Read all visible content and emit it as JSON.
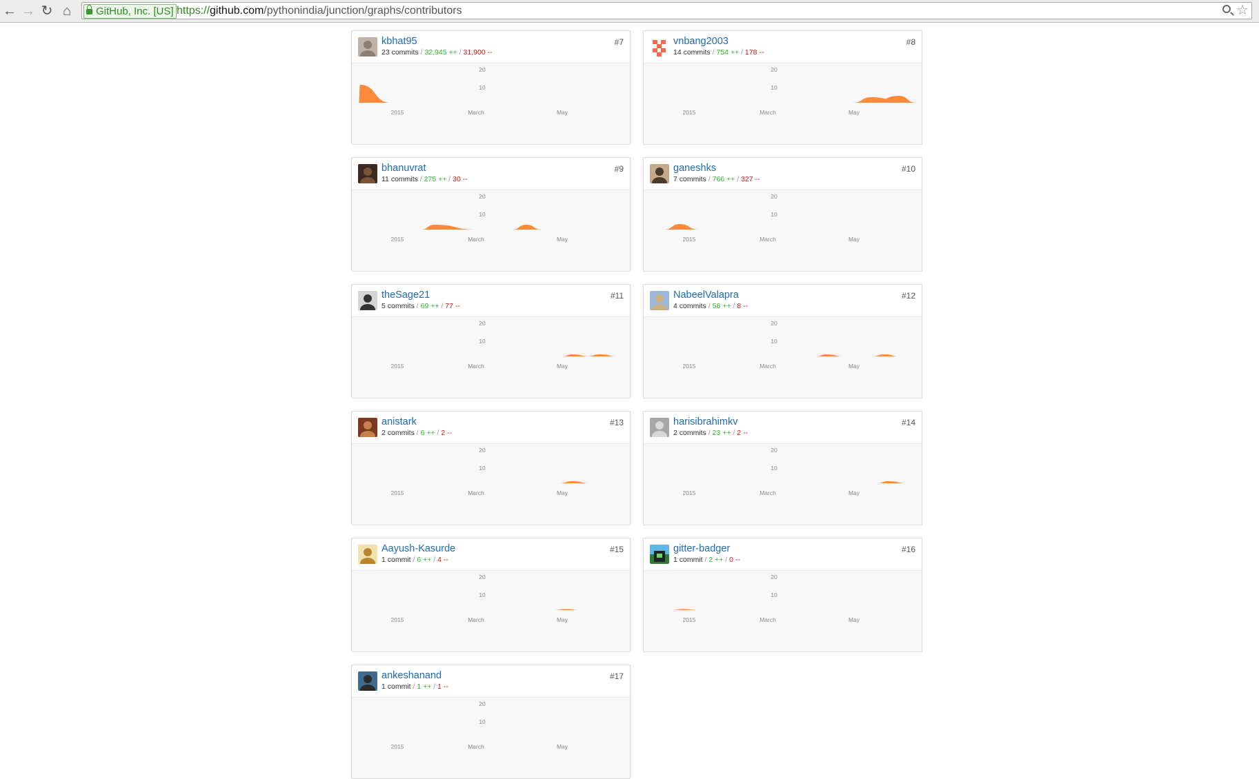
{
  "browser": {
    "ev_label": "GitHub, Inc. [US]",
    "url_scheme": "https://",
    "url_host": "github.com",
    "url_path": "/pythonindia/junction/graphs/contributors",
    "icons": [
      "back-arrow-icon",
      "forward-arrow-icon",
      "reload-icon",
      "home-icon",
      "lock-icon",
      "search-icon",
      "star-icon"
    ]
  },
  "chart_defaults": {
    "y_ticks": [
      "20",
      "10"
    ],
    "x_ticks": [
      "2015",
      "March",
      "May"
    ],
    "area_color": "#fb8532"
  },
  "contributors": [
    {
      "username": "kbhat95",
      "rank": "#7",
      "commits": "23 commits",
      "additions": "32,945 ++",
      "deletions": "31,900 --"
    },
    {
      "username": "vnbang2003",
      "rank": "#8",
      "commits": "14 commits",
      "additions": "754 ++",
      "deletions": "178 --"
    },
    {
      "username": "bhanuvrat",
      "rank": "#9",
      "commits": "11 commits",
      "additions": "275 ++",
      "deletions": "30 --"
    },
    {
      "username": "ganeshks",
      "rank": "#10",
      "commits": "7 commits",
      "additions": "766 ++",
      "deletions": "327 --"
    },
    {
      "username": "theSage21",
      "rank": "#11",
      "commits": "5 commits",
      "additions": "69 ++",
      "deletions": "77 --"
    },
    {
      "username": "NabeelValapra",
      "rank": "#12",
      "commits": "4 commits",
      "additions": "58 ++",
      "deletions": "8 --"
    },
    {
      "username": "anistark",
      "rank": "#13",
      "commits": "2 commits",
      "additions": "6 ++",
      "deletions": "2 --"
    },
    {
      "username": "harisibrahimkv",
      "rank": "#14",
      "commits": "2 commits",
      "additions": "23 ++",
      "deletions": "2 --"
    },
    {
      "username": "Aayush-Kasurde",
      "rank": "#15",
      "commits": "1 commit",
      "additions": "6 ++",
      "deletions": "4 --"
    },
    {
      "username": "gitter-badger",
      "rank": "#16",
      "commits": "1 commit",
      "additions": "2 ++",
      "deletions": "0 --"
    },
    {
      "username": "ankeshanand",
      "rank": "#17",
      "commits": "1 commit",
      "additions": "1 ++",
      "deletions": "1 --"
    }
  ]
}
